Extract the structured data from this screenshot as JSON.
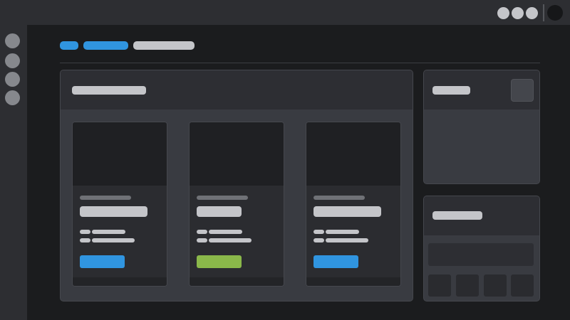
{
  "colors": {
    "page_bg": "#1b1c1e",
    "chrome_bg": "#2d2e32",
    "panel_bg": "#393b41",
    "panel_header_bg": "#2d2e33",
    "card_bg": "#2b2c30",
    "placeholder_text": "#c4c5c9",
    "muted_text": "#6f7176",
    "accent_blue": "#3095e0",
    "accent_green": "#8ab84a"
  },
  "window": {
    "controls": [
      "window-control-icon",
      "window-control-icon",
      "window-control-icon"
    ],
    "avatar_icon": "avatar-icon"
  },
  "sidebar": {
    "items": [
      {
        "icon": "nav-icon"
      },
      {
        "icon": "nav-icon"
      },
      {
        "icon": "nav-icon"
      },
      {
        "icon": "nav-icon"
      }
    ]
  },
  "breadcrumb": {
    "items": [
      {
        "label": "",
        "color": "#3095e0"
      },
      {
        "label": "",
        "color": "#3095e0"
      },
      {
        "label": "",
        "color": "#c4c5c9"
      }
    ]
  },
  "main_panel": {
    "title": "",
    "cards": [
      {
        "image_icon": "image-placeholder-icon",
        "eyebrow": "",
        "title": "",
        "meta": [
          "",
          ""
        ],
        "button_label": "",
        "button_color": "#3095e0"
      },
      {
        "image_icon": "image-placeholder-icon",
        "eyebrow": "",
        "title": "",
        "meta": [
          "",
          ""
        ],
        "button_label": "",
        "button_color": "#8ab84a"
      },
      {
        "image_icon": "image-placeholder-icon",
        "eyebrow": "",
        "title": "",
        "meta": [
          "",
          ""
        ],
        "button_label": "",
        "button_color": "#3095e0"
      }
    ]
  },
  "side_panel_top": {
    "title": "",
    "action_icon": "square-action-icon"
  },
  "side_panel_bottom": {
    "title": "",
    "field_value": "",
    "tiles": [
      {
        "label": ""
      },
      {
        "label": ""
      },
      {
        "label": ""
      },
      {
        "label": ""
      }
    ]
  }
}
